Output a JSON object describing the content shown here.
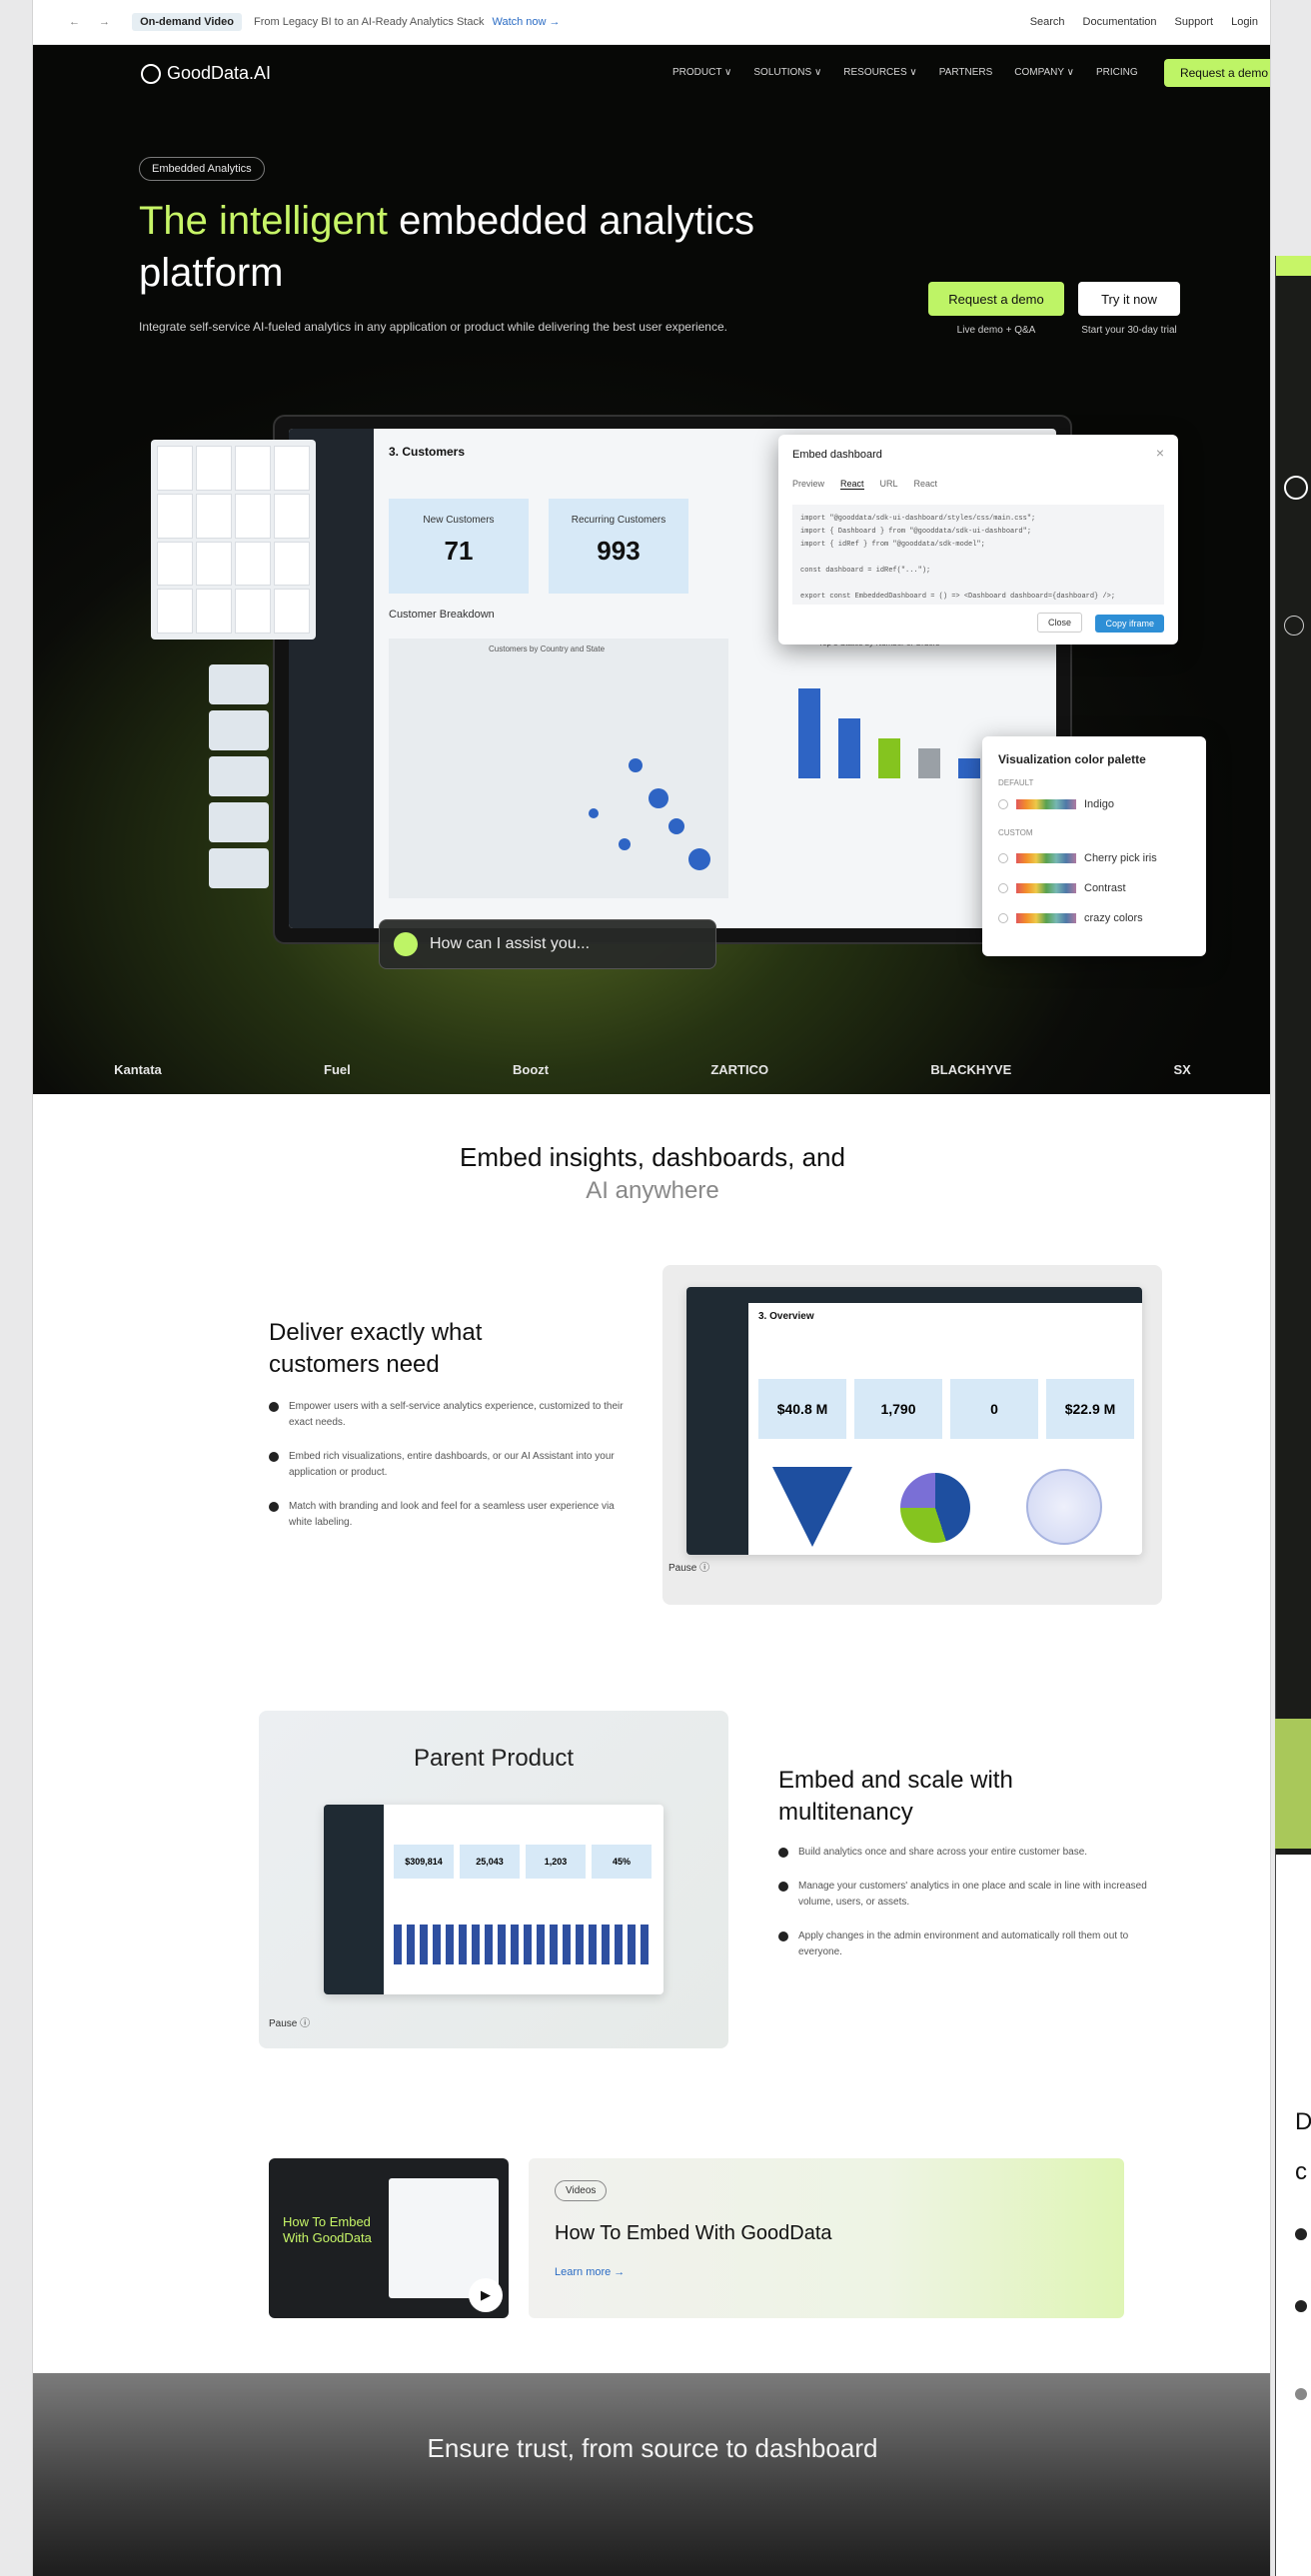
{
  "announce": {
    "nav": "← →",
    "pill": "On-demand Video",
    "msg": "From Legacy BI to an AI-Ready Analytics Stack",
    "watch": "Watch now →",
    "search": "Search",
    "docs": "Documentation",
    "support": "Support",
    "login": "Login"
  },
  "header": {
    "logo": "GoodData.AI",
    "nav": [
      "PRODUCT ∨",
      "SOLUTIONS ∨",
      "RESOURCES ∨",
      "PARTNERS",
      "COMPANY ∨",
      "PRICING"
    ],
    "cta": "Request a demo"
  },
  "hero": {
    "tag": "Embedded Analytics",
    "title_hl": "The intelligent",
    "title_rest": " embedded analytics platform",
    "lead": "Integrate self-service AI-fueled analytics in any application or product while delivering the best user experience.",
    "demo_btn": "Request a demo",
    "demo_sub": "Live demo + Q&A",
    "try_btn": "Try it now",
    "try_sub": "Start your 30-day trial"
  },
  "dashboard": {
    "title": "3. Customers",
    "kpis": [
      {
        "label": "New Customers",
        "value": "71"
      },
      {
        "label": "Recurring Customers",
        "value": "993"
      }
    ],
    "breakdown": "Customer Breakdown",
    "map_title": "Customers by Country and State",
    "bars_title": "Top 5 States by Number of Orders"
  },
  "embed_modal": {
    "title": "Embed dashboard",
    "tabs": [
      "Preview",
      "React",
      "URL",
      "React"
    ],
    "close": "Close",
    "copy": "Copy iframe"
  },
  "palette": {
    "title": "Visualization color palette",
    "default_label": "DEFAULT",
    "custom_label": "CUSTOM",
    "items": [
      "Indigo",
      "Cherry pick iris",
      "Contrast",
      "crazy colors"
    ]
  },
  "assistant": {
    "text": "How can I assist you..."
  },
  "logos": [
    "Kantata",
    "Fuel",
    "Boozt",
    "ZARTICO",
    "BLACKHYVE",
    "SX"
  ],
  "section": {
    "title": "Embed insights, dashboards, and",
    "subtitle": "AI anywhere"
  },
  "feature1": {
    "title": "Deliver exactly what customers need",
    "bullets": [
      "Empower users with a self-service analytics experience, customized to their exact needs.",
      "Embed rich visualizations, entire dashboards, or our AI Assistant into your application or product.",
      "Match with branding and look and feel for a seamless user experience via white labeling."
    ],
    "dash_title": "3. Overview",
    "kpis": [
      "$40.8 M",
      "1,790",
      "0",
      "$22.9 M"
    ],
    "pause": "Pause"
  },
  "feature2": {
    "panel_title": "Parent Product",
    "title": "Embed and scale with multitenancy",
    "bullets": [
      "Build analytics once and share across your entire customer base.",
      "Manage your customers' analytics in one place and scale in line with increased volume, users, or assets.",
      "Apply changes in the admin environment and automatically roll them out to everyone."
    ],
    "kpis": [
      "$309,814",
      "25,043",
      "1,203",
      "45%"
    ],
    "pause": "Pause"
  },
  "video": {
    "thumb_title": "How To Embed With GoodData",
    "badge": "Videos",
    "title": "How To Embed With GoodData",
    "link": "Learn more →"
  },
  "trust": {
    "title": "Ensure trust, from source to dashboard"
  },
  "overlay": {
    "letter1": "D",
    "letter2": "c"
  }
}
